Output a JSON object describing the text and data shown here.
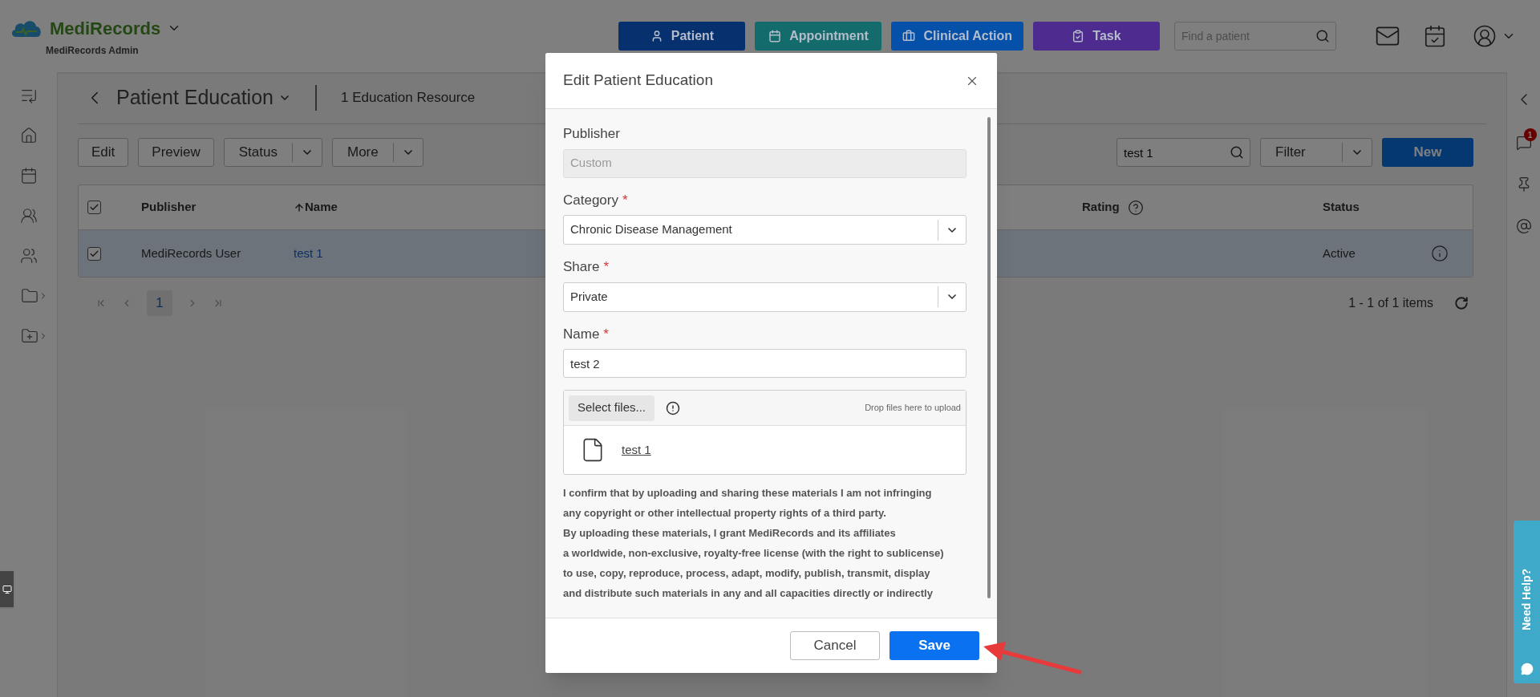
{
  "app": {
    "brand": "MediRecords",
    "subtitle": "MediRecords Admin"
  },
  "top_actions": [
    {
      "label": "Patient",
      "color": "#06306e"
    },
    {
      "label": "Appointment",
      "color": "#136b6b"
    },
    {
      "label": "Clinical Action",
      "color": "#0550a8"
    },
    {
      "label": "Task",
      "color": "#4e2b8e"
    }
  ],
  "patient_search": {
    "placeholder": "Find a patient"
  },
  "page": {
    "title": "Patient Education",
    "count": "1 Education Resource"
  },
  "toolbar": {
    "buttons": [
      {
        "label": "Edit",
        "kind": "button"
      },
      {
        "label": "Preview",
        "kind": "button"
      },
      {
        "label": "Status",
        "kind": "split"
      },
      {
        "label": "More",
        "kind": "split"
      }
    ],
    "search": {
      "value": "test 1"
    },
    "filter": {
      "label": "Filter"
    },
    "new_button": "New"
  },
  "table": {
    "all_checked": true,
    "columns": [
      {
        "label": "Publisher",
        "sorted": false,
        "help": false
      },
      {
        "label": "Name",
        "sorted": true,
        "help": false
      },
      {
        "label": "Rating",
        "sorted": false,
        "help": true
      },
      {
        "label": "Status",
        "sorted": false,
        "help": false
      }
    ],
    "rows": [
      {
        "checked": true,
        "selected": true,
        "publisher": "MediRecords User",
        "name": "test 1",
        "status": "Active"
      }
    ]
  },
  "pagination": {
    "pages": [
      {
        "label": "1",
        "selected": true
      }
    ],
    "summary": "1 - 1 of 1 items"
  },
  "notifications": {
    "badge": "1"
  },
  "help_tab": {
    "label": "Need Help?"
  },
  "dialog": {
    "title": "Edit Patient Education",
    "required_mark": "*",
    "fields": [
      {
        "kind": "readonly",
        "label": "Publisher",
        "required": false,
        "value": "Custom"
      },
      {
        "kind": "select",
        "label": "Category",
        "required": true,
        "value": "Chronic Disease Management"
      },
      {
        "kind": "select",
        "label": "Share",
        "required": true,
        "value": "Private"
      },
      {
        "kind": "input",
        "label": "Name",
        "required": true,
        "value": "test 2"
      }
    ],
    "upload": {
      "button": "Select files...",
      "hint": "Drop files here to upload",
      "files": [
        "test 1"
      ]
    },
    "consent_lines": [
      "I confirm that by uploading and sharing these materials I am not infringing",
      "any copyright or other intellectual property rights of a third party.",
      "By uploading these materials, I grant MediRecords and its affiliates",
      "a worldwide, non-exclusive, royalty-free license (with the right to sublicense)",
      "to use, copy, reproduce, process, adapt, modify, publish, transmit, display",
      "and distribute such materials in any and all capacities directly or indirectly"
    ],
    "buttons": [
      {
        "label": "Cancel",
        "kind": "secondary"
      },
      {
        "label": "Save",
        "kind": "primary"
      }
    ]
  }
}
